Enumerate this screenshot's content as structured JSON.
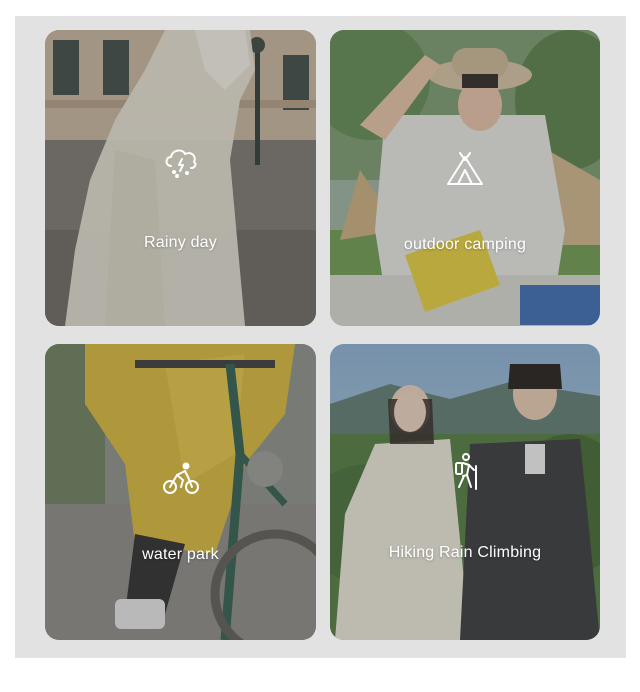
{
  "cards": [
    {
      "label": "Rainy day",
      "icon": "rain-cloud-icon"
    },
    {
      "label": "outdoor camping",
      "icon": "tent-icon"
    },
    {
      "label": "water park",
      "icon": "bicycle-rider-icon"
    },
    {
      "label": "Hiking Rain Climbing",
      "icon": "hiker-icon"
    }
  ],
  "colors": {
    "frame": "#e2e2e2",
    "label": "#ffffff"
  }
}
